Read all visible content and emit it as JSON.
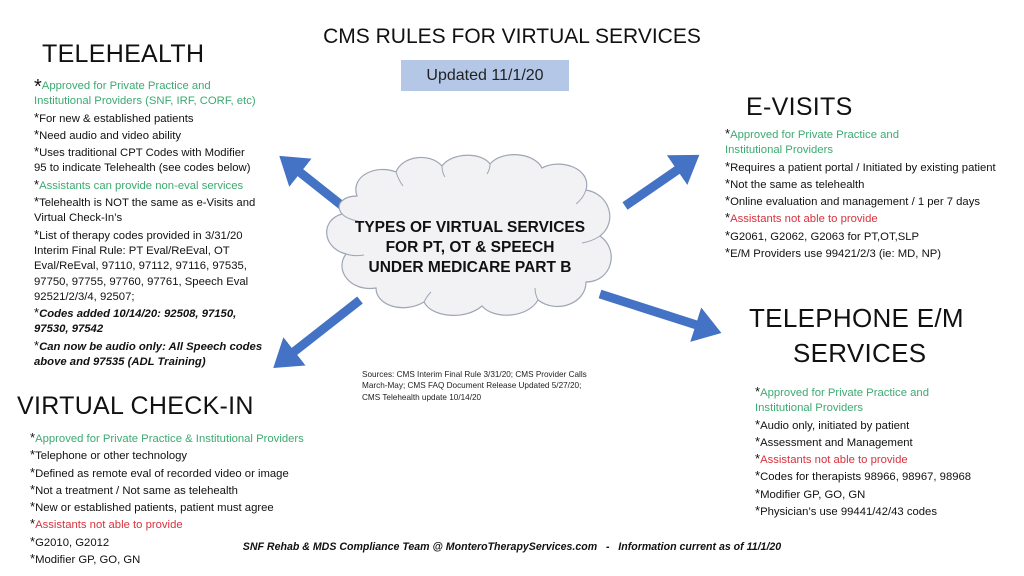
{
  "header": {
    "title": "CMS RULES FOR VIRTUAL SERVICES",
    "updated_badge": "Updated 11/1/20"
  },
  "center": {
    "lines": [
      "TYPES OF VIRTUAL SERVICES",
      "FOR PT, OT & SPEECH",
      "UNDER MEDICARE PART B"
    ]
  },
  "colors": {
    "arrow": "#4472c4",
    "badge_bg": "#b4c7e7",
    "cloud_fill": "#f2f2f4",
    "cloud_stroke": "#9ea6b4",
    "approved_green": "#3daa72",
    "not_able_red": "#d8333d"
  },
  "telehealth": {
    "heading": "TELEHEALTH",
    "lines": [
      {
        "text": "Approved for Private Practice and",
        "style": "green",
        "bullet": "big"
      },
      {
        "text": "Institutional Providers (SNF, IRF, CORF, etc)",
        "style": "green",
        "bullet": ""
      },
      {
        "text": "For new & established patients",
        "style": "normal",
        "bullet": "*"
      },
      {
        "text": "Need audio and video ability",
        "style": "normal",
        "bullet": "*"
      },
      {
        "text": "Uses traditional CPT Codes with Modifier",
        "style": "normal",
        "bullet": "*"
      },
      {
        "text": "95 to indicate Telehealth (see codes below)",
        "style": "normal",
        "bullet": ""
      },
      {
        "text": "Assistants can provide non-eval services",
        "style": "green",
        "bullet": "*"
      },
      {
        "text": "Telehealth is NOT the same as e-Visits and",
        "style": "normal",
        "bullet": "*"
      },
      {
        "text": "Virtual Check-In’s",
        "style": "normal",
        "bullet": ""
      },
      {
        "text": "List of therapy codes provided in 3/31/20",
        "style": "normal",
        "bullet": "*"
      },
      {
        "text": "Interim Final Rule:  PT Eval/ReEval, OT",
        "style": "normal",
        "bullet": ""
      },
      {
        "text": "Eval/ReEval, 97110, 97112, 97116, 97535,",
        "style": "normal",
        "bullet": ""
      },
      {
        "text": "97750, 97755, 97760, 97761, Speech Eval",
        "style": "normal",
        "bullet": ""
      },
      {
        "text": "92521/2/3/4, 92507;",
        "style": "normal",
        "bullet": ""
      },
      {
        "text": "Codes added 10/14/20: 92508, 97150,",
        "style": "bolditalic",
        "bullet": "*"
      },
      {
        "text": "97530, 97542",
        "style": "bolditalic",
        "bullet": ""
      },
      {
        "text": "Can now be audio only: All Speech codes",
        "style": "bolditalic",
        "bullet": "*"
      },
      {
        "text": "above and 97535 (ADL Training)",
        "style": "bolditalic",
        "bullet": ""
      }
    ]
  },
  "evisits": {
    "heading": "E-VISITS",
    "lines": [
      {
        "text": "Approved for Private Practice and",
        "style": "green",
        "bullet": "*"
      },
      {
        "text": "Institutional Providers",
        "style": "green",
        "bullet": ""
      },
      {
        "text": "Requires a patient portal / Initiated by existing patient",
        "style": "normal",
        "bullet": "*"
      },
      {
        "text": "Not the same as telehealth",
        "style": "normal",
        "bullet": "*"
      },
      {
        "text": "Online evaluation and management / 1 per 7 days",
        "style": "normal",
        "bullet": "*"
      },
      {
        "text": "Assistants not able to provide",
        "style": "red",
        "bullet": "*"
      },
      {
        "text": "G2061, G2062, G2063 for PT,OT,SLP",
        "style": "normal",
        "bullet": "*"
      },
      {
        "text": "E/M Providers use 99421/2/3 (ie: MD, NP)",
        "style": "normal",
        "bullet": "*"
      }
    ]
  },
  "telephone": {
    "heading_line1": "TELEPHONE E/M",
    "heading_line2": "SERVICES",
    "lines": [
      {
        "text": "Approved for Private Practice and",
        "style": "green",
        "bullet": "*"
      },
      {
        "text": "Institutional Providers",
        "style": "green",
        "bullet": ""
      },
      {
        "text": "Audio only, initiated by patient",
        "style": "normal",
        "bullet": "*"
      },
      {
        "text": "Assessment and Management",
        "style": "normal",
        "bullet": "*"
      },
      {
        "text": "Assistants not able to provide",
        "style": "red",
        "bullet": "*"
      },
      {
        "text": "Codes for therapists 98966, 98967, 98968",
        "style": "normal",
        "bullet": "*"
      },
      {
        "text": "Modifier GP, GO, GN",
        "style": "normal",
        "bullet": "*"
      },
      {
        "text": "Physician’s use 99441/42/43 codes",
        "style": "normal",
        "bullet": "*"
      }
    ]
  },
  "checkin": {
    "heading": "VIRTUAL CHECK-IN",
    "lines": [
      {
        "text": "Approved for Private Practice & Institutional Providers",
        "style": "green",
        "bullet": "*"
      },
      {
        "text": "Telephone or other technology",
        "style": "normal",
        "bullet": "*"
      },
      {
        "text": "Defined as remote eval of recorded video or image",
        "style": "normal",
        "bullet": "*"
      },
      {
        "text": "Not a treatment / Not same as telehealth",
        "style": "normal",
        "bullet": "*"
      },
      {
        "text": "New or established patients, patient must agree",
        "style": "normal",
        "bullet": "*"
      },
      {
        "text": "Assistants not able to provide",
        "style": "red",
        "bullet": "*"
      },
      {
        "text": "G2010, G2012",
        "style": "normal",
        "bullet": "*"
      },
      {
        "text": "Modifier GP, GO, GN",
        "style": "normal",
        "bullet": "*"
      }
    ]
  },
  "sources": {
    "lines": [
      "Sources: CMS Interim Final Rule 3/31/20; CMS Provider Calls",
      "March-May; CMS FAQ Document Release Updated 5/27/20;",
      "CMS Telehealth update 10/14/20"
    ]
  },
  "footer": {
    "text": "SNF Rehab & MDS Compliance Team @ MonteroTherapyServices.com   -   Information current as of 11/1/20"
  }
}
